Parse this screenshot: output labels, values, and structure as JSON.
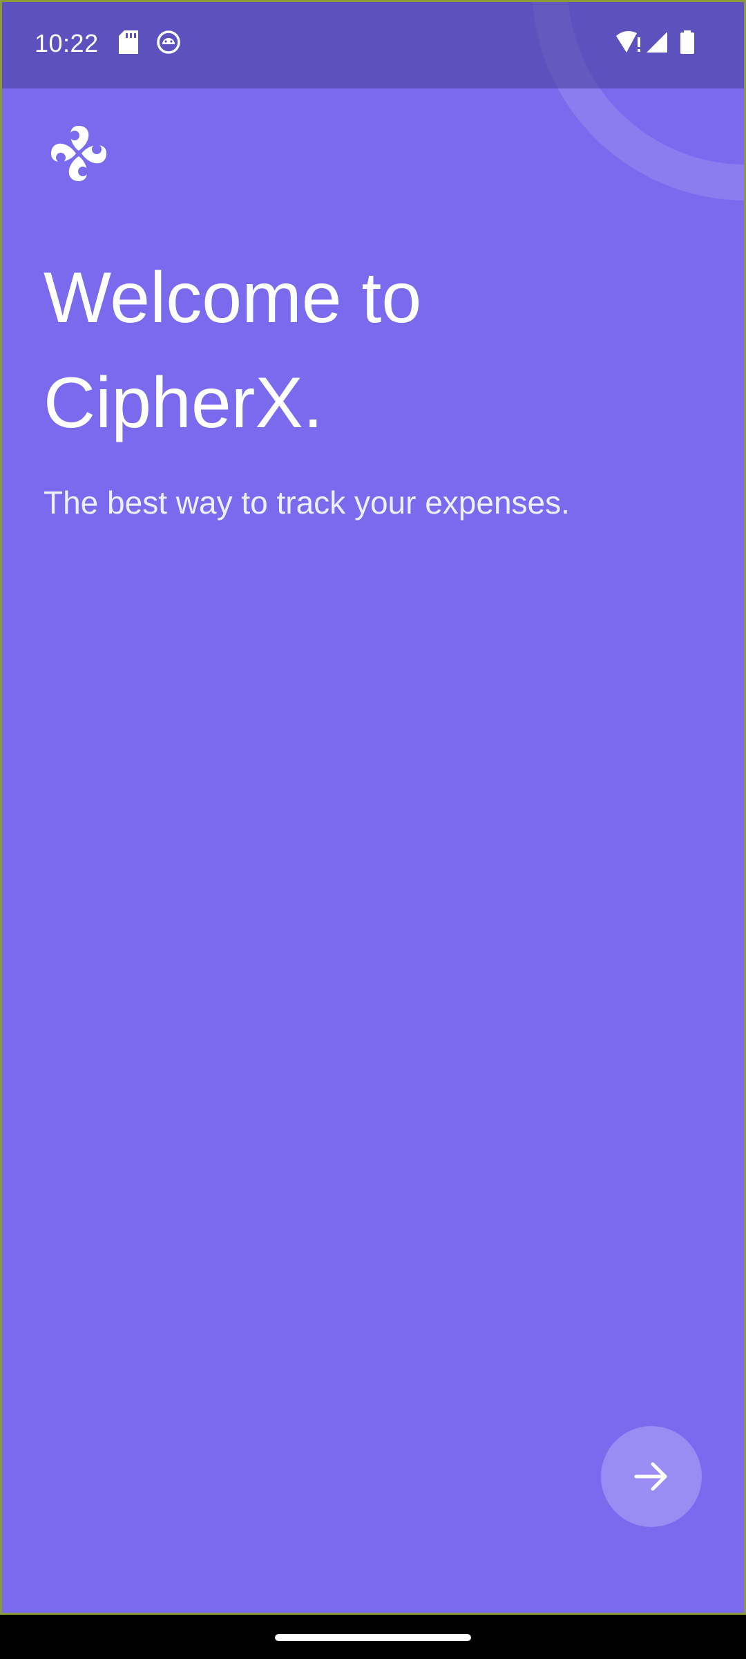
{
  "status_bar": {
    "time": "10:22",
    "left_icons": [
      "sd-card-icon",
      "android-debug-icon"
    ],
    "right_icons": [
      "wifi-alert-icon",
      "cell-signal-icon",
      "battery-icon"
    ]
  },
  "app": {
    "logo_icon": "cipherx-logo-icon",
    "headline_line1": "Welcome to",
    "headline_line2": "CipherX.",
    "subtitle": "The best way to track your expenses."
  },
  "actions": {
    "next_icon": "arrow-right-icon"
  },
  "colors": {
    "background": "#7B6AEE",
    "status_bar": "#5E52B4",
    "fab": "#9A8CF2",
    "text": "#FFFFFF"
  }
}
